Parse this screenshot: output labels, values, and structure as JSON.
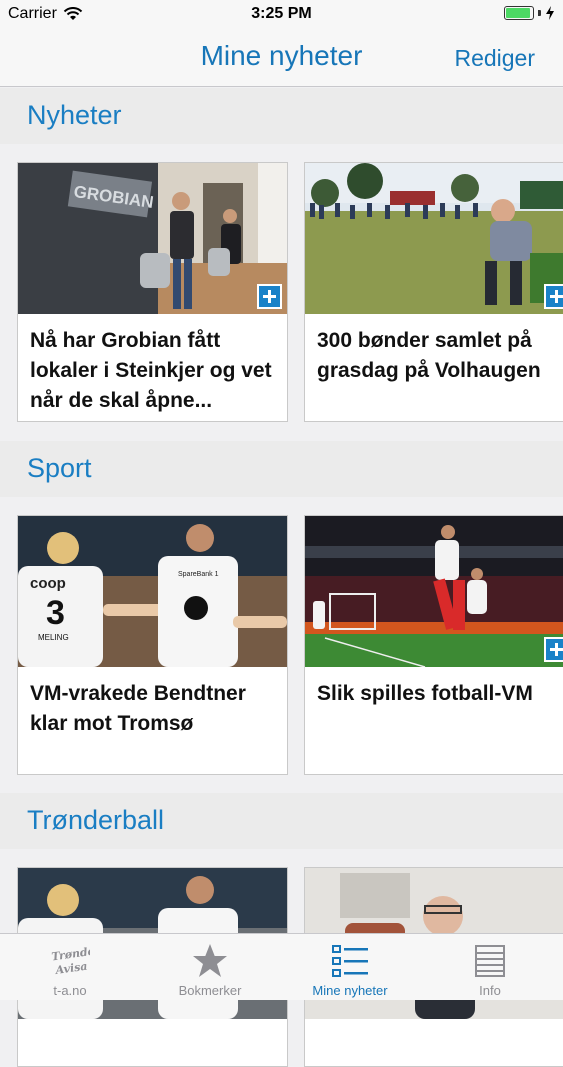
{
  "status_bar": {
    "carrier": "Carrier",
    "time": "3:25 PM"
  },
  "nav": {
    "title": "Mine nyheter",
    "edit_label": "Rediger"
  },
  "sections": [
    {
      "title": "Nyheter",
      "articles": [
        {
          "title": "Nå har Grobian fått lokaler i Steinkjer og vet når de skal åpne...",
          "image": "Grobian",
          "plus": true
        },
        {
          "title": "300 bønder samlet på grasdag på Volhaugen",
          "image": "field-crowd",
          "plus": true
        }
      ]
    },
    {
      "title": "Sport",
      "articles": [
        {
          "title": "VM-vrakede Bendtner klar mot Tromsø",
          "image": "football-celebration",
          "plus": false
        },
        {
          "title": "Slik spilles fotball-VM",
          "image": "stadium-match",
          "plus": true
        }
      ]
    },
    {
      "title": "Trønderball",
      "articles": [
        {
          "title": "",
          "image": "football-celebration",
          "plus": false
        },
        {
          "title": "",
          "image": "man-portrait",
          "plus": false
        }
      ]
    }
  ],
  "image_text": {
    "grobian_sign": "GROBIAN",
    "jersey_brand": "coop",
    "jersey_number": "3",
    "jersey_name": "MELING",
    "jersey_sponsor": "SpareBank 1"
  },
  "tabs": [
    {
      "label": "t-a.no",
      "icon": "tronder-avisa-logo-icon",
      "logo_text": "Trønder-\nAvisa",
      "active": false
    },
    {
      "label": "Bokmerker",
      "icon": "star-icon",
      "active": false
    },
    {
      "label": "Mine nyheter",
      "icon": "list-icon",
      "active": true
    },
    {
      "label": "Info",
      "icon": "lines-icon",
      "active": false
    }
  ],
  "colors": {
    "accent": "#1776b8",
    "section_title": "#1a7ec3",
    "plus_badge": "#1a82c8",
    "battery": "#4cd964"
  }
}
